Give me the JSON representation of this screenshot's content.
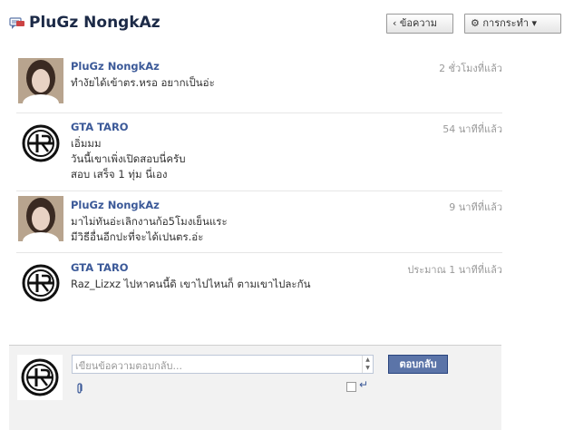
{
  "header": {
    "title": "PluGz NongkAz",
    "back_label": "‹ ข้อความ",
    "actions_label": "⚙ การกระทำ ▾"
  },
  "messages": [
    {
      "name": "PluGz NongkAz",
      "time": "2 ชั่วโมงที่แล้ว",
      "lines": [
        "ทำงัยได้เข้าตร.หรอ อยากเป็นอ่ะ"
      ],
      "avatar": "photo-avatar"
    },
    {
      "name": "GTA TARO",
      "time": "54 นาทีที่แล้ว",
      "lines": [
        "เอิ่มมม",
        "วันนี้เขาเพิ่งเปิดสอบนี่ครับ",
        "สอบ เสร็จ 1 ทุ่ม นี่เอง"
      ],
      "avatar": "tr-logo-avatar"
    },
    {
      "name": "PluGz NongkAz",
      "time": "9 นาทีที่แล้ว",
      "lines": [
        "มาไม่ทันอ่ะเลิกงานก้อ5โมงเย็นแระ",
        "มีวิธีอื่นอีกปะที่จะได้เปนตร.อ่ะ"
      ],
      "avatar": "photo-avatar"
    },
    {
      "name": "GTA TARO",
      "time": "ประมาณ 1 นาทีที่แล้ว",
      "lines": [
        "Raz_Lizxz ไปหาคนนี้ดิ เขาไปไหนก็ ตามเขาไปละกัน"
      ],
      "avatar": "tr-logo-avatar"
    }
  ],
  "composer": {
    "placeholder": "เขียนข้อความตอบกลับ...",
    "reply_label": "ตอบกลับ",
    "icons": [
      "paperclip-icon",
      "enter-icon"
    ],
    "enter_to_send_checked": false
  },
  "colors": {
    "link": "#3b5998",
    "button": "#5b74a8",
    "composer_bg": "#f2f2f2"
  }
}
